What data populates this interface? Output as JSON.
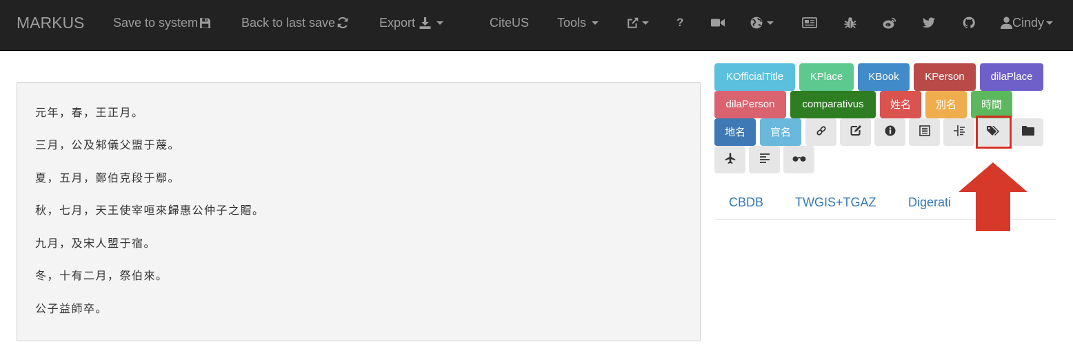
{
  "navbar": {
    "brand": "MARKUS",
    "save_label": "Save to system",
    "back_label": "Back to last save",
    "export_label": "Export",
    "citeus_label": "CiteUS",
    "tools_label": "Tools",
    "help_label": "?",
    "user_label": "Cindy",
    "icons": [
      "floppy-icon",
      "refresh-icon",
      "download-icon",
      "external-link-icon",
      "video-icon",
      "globe-icon",
      "newspaper-icon",
      "bug-icon",
      "weibo-icon",
      "twitter-icon",
      "github-icon",
      "user-icon"
    ]
  },
  "text": {
    "lines": [
      "元年，春，王正月。",
      "三月，公及邾儀父盟于蔑。",
      "夏，五月，鄭伯克段于鄢。",
      "秋，七月，天王使宰咺來歸惠公仲子之賵。",
      "九月，及宋人盟于宿。",
      "冬，十有二月，祭伯來。",
      "公子益師卒。"
    ]
  },
  "tags": {
    "row1": [
      {
        "label": "KOfficialTitle",
        "color": "#5bc0de"
      },
      {
        "label": "KPlace",
        "color": "#5ec98e"
      },
      {
        "label": "KBook",
        "color": "#428bca"
      },
      {
        "label": "KPerson",
        "color": "#b94a48"
      },
      {
        "label": "dilaPlace",
        "color": "#6f5fc9"
      }
    ],
    "row2": [
      {
        "label": "dilaPerson",
        "color": "#d9636f"
      },
      {
        "label": "comparativus",
        "color": "#2e7d22"
      },
      {
        "label": "姓名",
        "color": "#d9534f"
      },
      {
        "label": "別名",
        "color": "#f0ad4e"
      },
      {
        "label": "時間",
        "color": "#5cb85c"
      }
    ],
    "row3": [
      {
        "label": "地名",
        "color": "#3f79b5"
      },
      {
        "label": "官名",
        "color": "#6ab8dc"
      }
    ],
    "tool_icons": [
      "link-icon",
      "edit-icon",
      "info-icon",
      "list-icon",
      "indent-icon",
      "tags-icon",
      "folder-icon",
      "plane-icon",
      "align-left-icon",
      "glasses-icon"
    ]
  },
  "links": {
    "items": [
      "CBDB",
      "TWGIS+TGAZ",
      "Digerati"
    ]
  },
  "annotation": {
    "highlight_color": "#d52b1e"
  }
}
